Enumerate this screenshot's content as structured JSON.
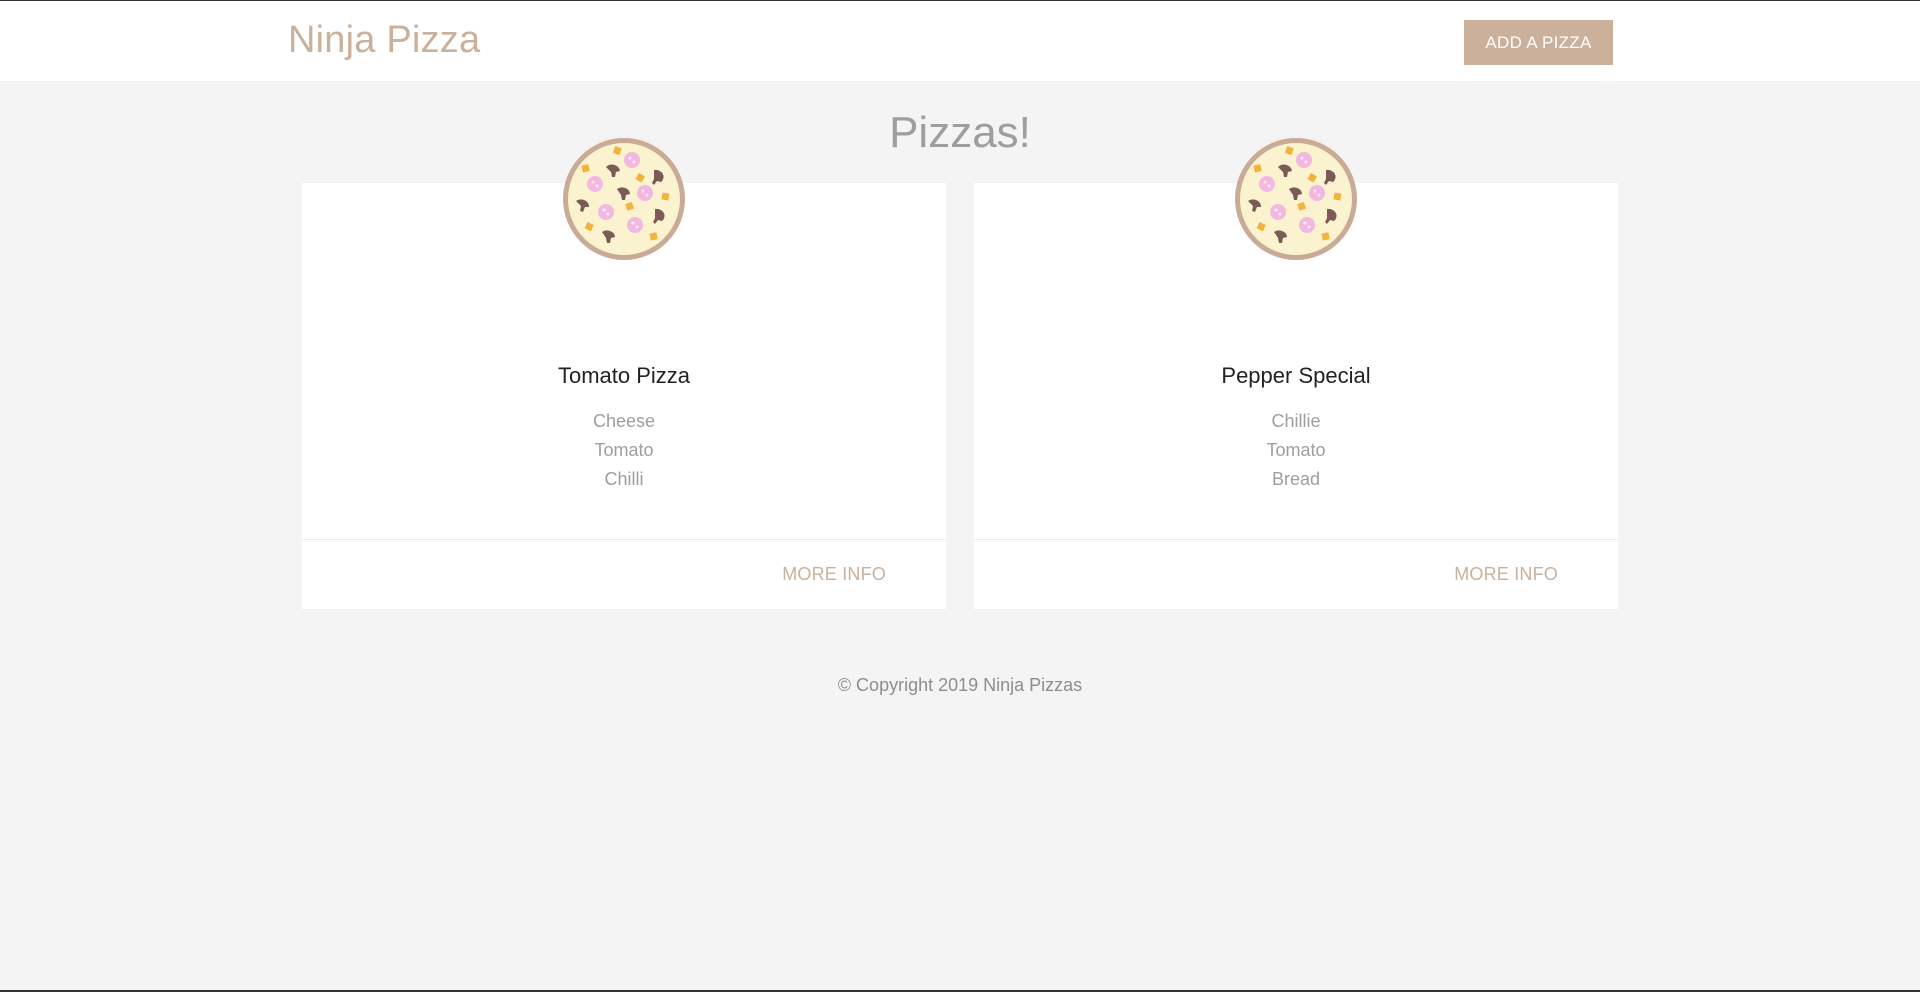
{
  "nav": {
    "brand": "Ninja Pizza",
    "add_button_label": "ADD A PIZZA"
  },
  "main": {
    "title": "Pizzas!",
    "pizzas": [
      {
        "title": "Tomato Pizza",
        "ingredients": [
          "Cheese",
          "Tomato",
          "Chilli"
        ],
        "action_label": "MORE INFO",
        "icon": "pizza-icon"
      },
      {
        "title": "Pepper Special",
        "ingredients": [
          "Chillie",
          "Tomato",
          "Bread"
        ],
        "action_label": "MORE INFO",
        "icon": "pizza-icon"
      }
    ]
  },
  "footer": {
    "text": "© Copyright 2019 Ninja Pizzas"
  },
  "colors": {
    "brand": "#cbb09c",
    "background": "#f4f4f4",
    "card": "#ffffff",
    "muted_text": "#9e9e9e"
  }
}
